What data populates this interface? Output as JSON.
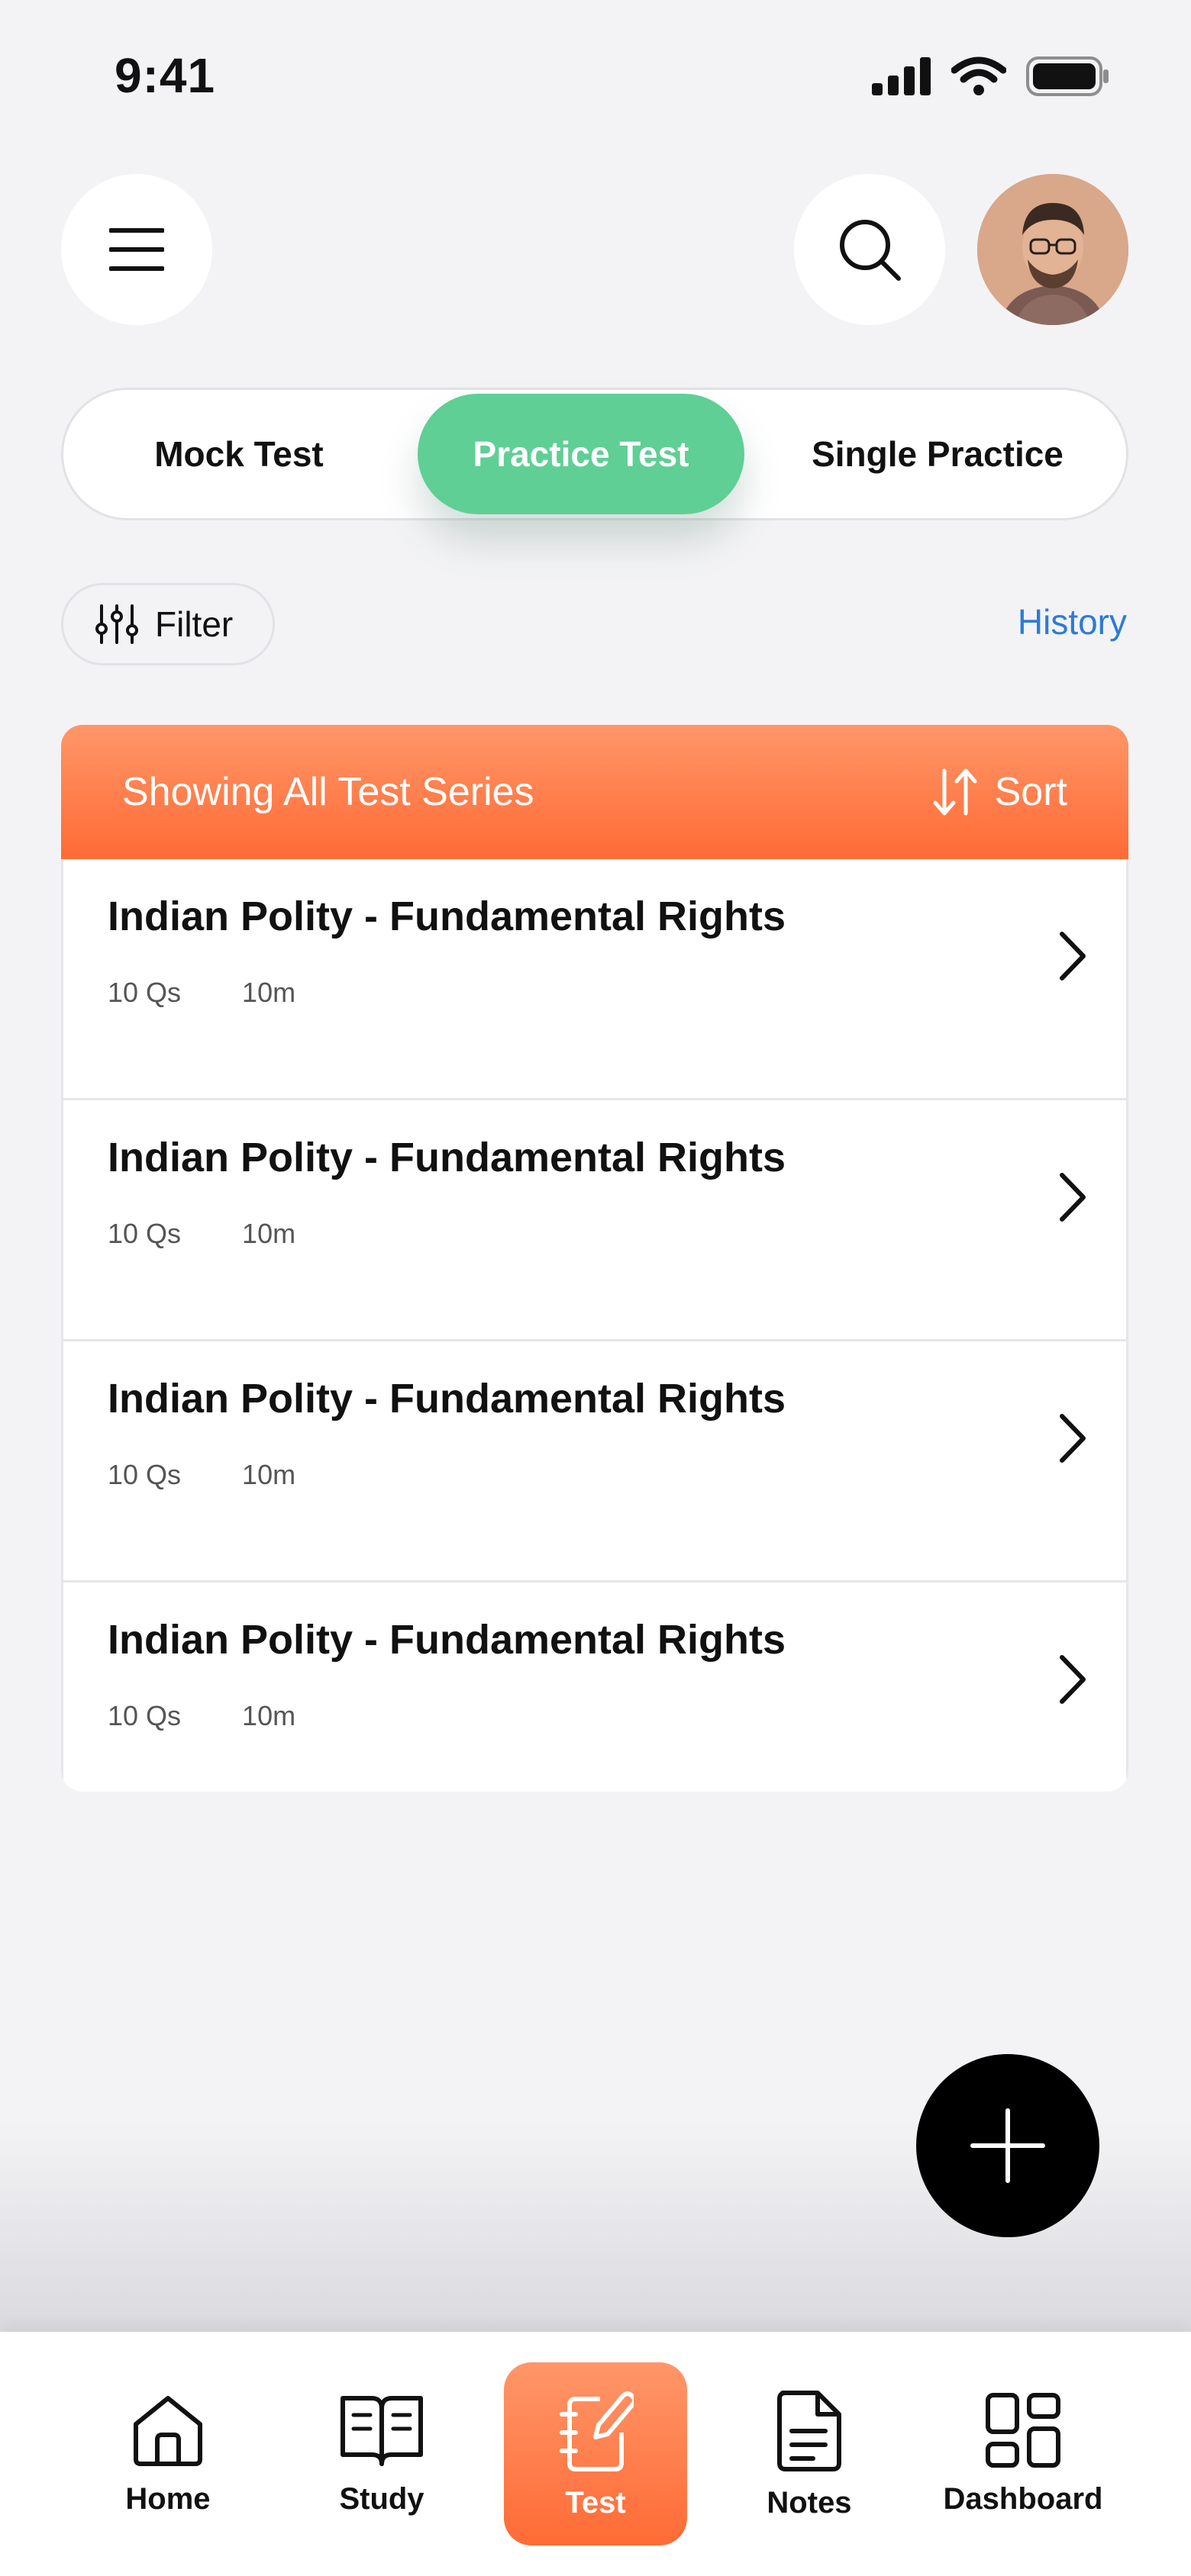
{
  "status_bar": {
    "time": "9:41"
  },
  "header": {
    "menu_icon": "hamburger-menu-icon",
    "search_icon": "search-icon",
    "avatar": "user-avatar"
  },
  "tabs": [
    {
      "label": "Mock Test",
      "active": false
    },
    {
      "label": "Practice Test",
      "active": true
    },
    {
      "label": "Single Practice",
      "active": false
    }
  ],
  "filter": {
    "label": "Filter",
    "icon": "sliders-icon"
  },
  "history_label": "History",
  "list": {
    "header_title": "Showing All Test Series",
    "sort_label": "Sort",
    "items": [
      {
        "title": "Indian Polity - Fundamental Rights",
        "questions": "10 Qs",
        "duration": "10m"
      },
      {
        "title": "Indian Polity - Fundamental Rights",
        "questions": "10 Qs",
        "duration": "10m"
      },
      {
        "title": "Indian Polity - Fundamental Rights",
        "questions": "10 Qs",
        "duration": "10m"
      },
      {
        "title": "Indian Polity - Fundamental Rights",
        "questions": "10 Qs",
        "duration": "10m"
      }
    ]
  },
  "fab_icon": "plus-icon",
  "bottom_nav": [
    {
      "label": "Home",
      "icon": "home-icon",
      "active": false
    },
    {
      "label": "Study",
      "icon": "book-icon",
      "active": false
    },
    {
      "label": "Test",
      "icon": "notebook-pen-icon",
      "active": true
    },
    {
      "label": "Notes",
      "icon": "document-icon",
      "active": false
    },
    {
      "label": "Dashboard",
      "icon": "dashboard-grid-icon",
      "active": false
    }
  ],
  "colors": {
    "accent_orange": "#ff6b35",
    "active_tab_green": "#5fcf95",
    "link_blue": "#2c7bd6",
    "background": "#f3f3f5"
  }
}
